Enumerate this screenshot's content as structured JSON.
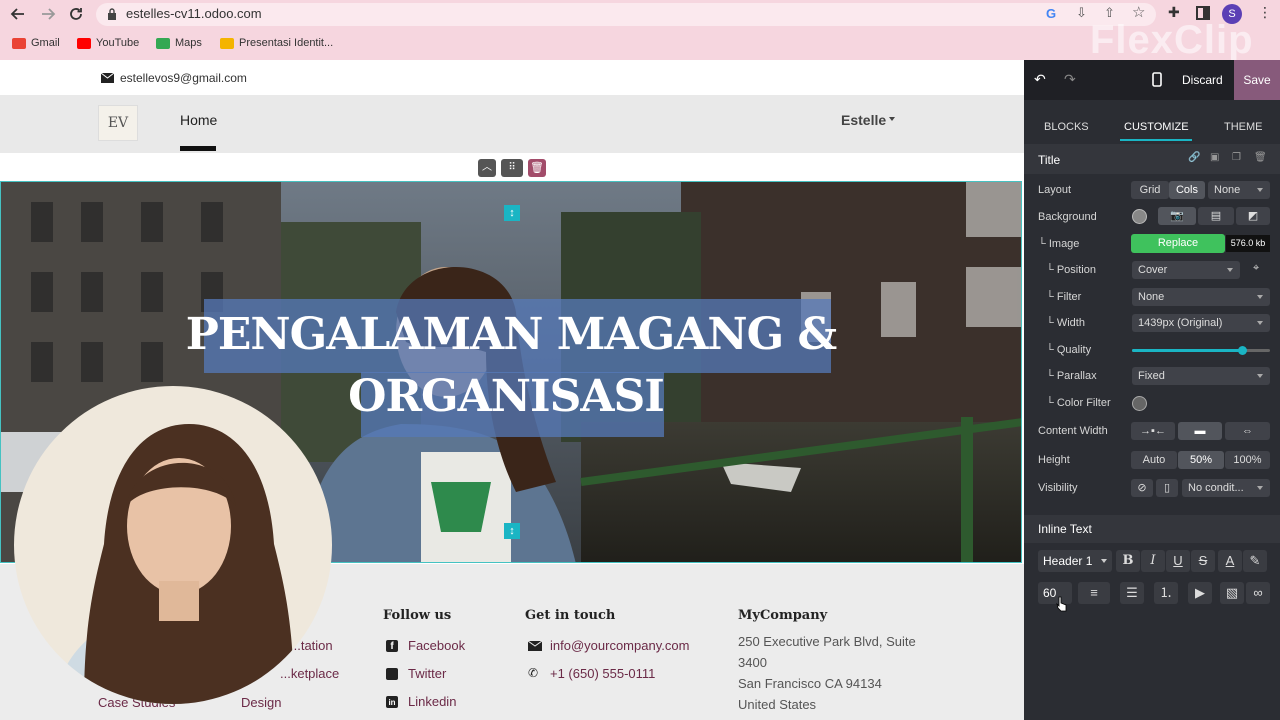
{
  "browser": {
    "url": "estelles-cv11.odoo.com",
    "profile_initial": "S",
    "bookmarks": [
      {
        "label": "Gmail",
        "color": "#ea4335"
      },
      {
        "label": "YouTube",
        "color": "#ff0000"
      },
      {
        "label": "Maps",
        "color": "#34a853"
      },
      {
        "label": "Presentasi Identit...",
        "color": "#f4b400"
      }
    ]
  },
  "watermark": "FlexClip",
  "site": {
    "email": "estellevos9@gmail.com",
    "logo_text": "EV",
    "nav_home": "Home",
    "user_menu": "Estelle",
    "hero_title_line1": "PENGALAMAN MAGANG &",
    "hero_title_line2": "ORGANISASI",
    "footer": {
      "col1_partial": [
        "...tation",
        "...ketplace"
      ],
      "col1_links": [
        "Case Studies",
        "Design"
      ],
      "follow_heading": "Follow us",
      "follow_links": [
        "Facebook",
        "Twitter",
        "Linkedin"
      ],
      "touch_heading": "Get in touch",
      "touch_email": "info@yourcompany.com",
      "touch_phone": "+1 (650) 555-0111",
      "company_heading": "MyCompany",
      "address": [
        "250 Executive Park Blvd, Suite",
        "3400",
        "San Francisco CA 94134",
        "United States"
      ]
    }
  },
  "editor": {
    "discard": "Discard",
    "save": "Save",
    "tabs": [
      "BLOCKS",
      "CUSTOMIZE",
      "THEME"
    ],
    "active_tab": "CUSTOMIZE",
    "section_title": "Title",
    "rows": {
      "layout": "Layout",
      "layout_grid": "Grid",
      "layout_cols": "Cols",
      "layout_none": "None",
      "background": "Background",
      "image": "└ Image",
      "replace": "Replace",
      "image_size": "576.0 kb",
      "position": "└ Position",
      "position_val": "Cover",
      "filter": "└ Filter",
      "filter_val": "None",
      "width": "└ Width",
      "width_val": "1439px (Original)",
      "quality": "└ Quality",
      "quality_level": 0.8,
      "parallax": "└ Parallax",
      "parallax_val": "Fixed",
      "color_filter": "└ Color Filter",
      "content_width": "Content Width",
      "height": "Height",
      "height_auto": "Auto",
      "height_50": "50%",
      "height_100": "100%",
      "visibility": "Visibility",
      "visibility_val": "No condit..."
    },
    "inline_text": "Inline Text",
    "header_select": "Header 1",
    "font_size": "60",
    "accent": "#1ab5c4",
    "save_bg": "#875a7b",
    "replace_bg": "#3fc25d"
  }
}
